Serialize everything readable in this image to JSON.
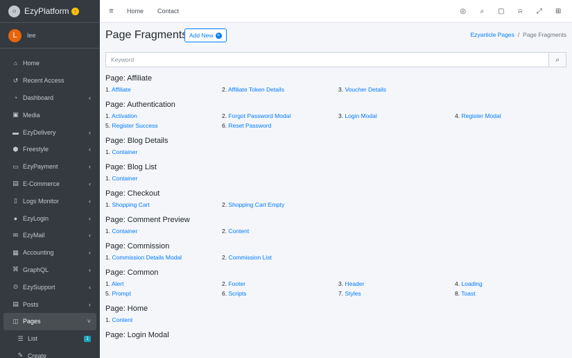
{
  "brand": {
    "name": "EzyPlatform",
    "badge": "↑"
  },
  "user": {
    "initial": "L",
    "name": "lee"
  },
  "sidebar": {
    "items": [
      {
        "label": "Home",
        "icon": "home-icon",
        "glyph": "⌂",
        "chevron": ""
      },
      {
        "label": "Recent Access",
        "icon": "history-icon",
        "glyph": "↺",
        "chevron": ""
      },
      {
        "label": "Dashboard",
        "icon": "dashboard-icon",
        "glyph": "◔",
        "chevron": "‹"
      },
      {
        "label": "Media",
        "icon": "image-icon",
        "glyph": "▣",
        "chevron": ""
      },
      {
        "label": "EzyDelivery",
        "icon": "truck-icon",
        "glyph": "▬",
        "chevron": "‹"
      },
      {
        "label": "Freestyle",
        "icon": "cube-icon",
        "glyph": "⬢",
        "chevron": "‹"
      },
      {
        "label": "EzyPayment",
        "icon": "credit-card-icon",
        "glyph": "▭",
        "chevron": "‹"
      },
      {
        "label": "E-Commerce",
        "icon": "store-icon",
        "glyph": "▤",
        "chevron": "‹"
      },
      {
        "label": "Logs Monitor",
        "icon": "file-icon",
        "glyph": "▯",
        "chevron": "‹"
      },
      {
        "label": "EzyLogin",
        "icon": "user-lock-icon",
        "glyph": "●",
        "chevron": "‹"
      },
      {
        "label": "EzyMail",
        "icon": "envelope-icon",
        "glyph": "✉",
        "chevron": "‹"
      },
      {
        "label": "Accounting",
        "icon": "calculator-icon",
        "glyph": "▦",
        "chevron": "‹"
      },
      {
        "label": "GraphQL",
        "icon": "project-diagram-icon",
        "glyph": "⌘",
        "chevron": "‹"
      },
      {
        "label": "EzySupport",
        "icon": "life-ring-icon",
        "glyph": "⊙",
        "chevron": "‹"
      },
      {
        "label": "Posts",
        "icon": "newspaper-icon",
        "glyph": "▤",
        "chevron": "‹"
      },
      {
        "label": "Pages",
        "icon": "columns-icon",
        "glyph": "◫",
        "chevron": "˅"
      }
    ],
    "sub_items": [
      {
        "label": "List",
        "icon": "list-icon",
        "glyph": "☰",
        "badge": "1"
      },
      {
        "label": "Create",
        "icon": "edit-icon",
        "glyph": "✎",
        "badge": ""
      }
    ]
  },
  "topbar": {
    "menu_glyph": "≡",
    "links": [
      "Home",
      "Contact"
    ],
    "icons": [
      {
        "name": "globe-icon",
        "glyph": "◎"
      },
      {
        "name": "search-icon",
        "glyph": "⌕"
      },
      {
        "name": "comments-icon",
        "glyph": "▢"
      },
      {
        "name": "bell-icon",
        "glyph": "⍾"
      },
      {
        "name": "expand-icon",
        "glyph": "⤢"
      },
      {
        "name": "th-large-icon",
        "glyph": "⊞"
      }
    ]
  },
  "page": {
    "title": "Page Fragments",
    "add_label": "Add New",
    "add_glyph": "+",
    "breadcrumb": {
      "link": "Ezyarticle Pages",
      "separator": "/",
      "current": "Page Fragments"
    },
    "search": {
      "placeholder": "Keyword",
      "value": "",
      "glyph": "⌕"
    }
  },
  "sections": [
    {
      "title": "Page: Affiliate",
      "items": [
        "Affiliate",
        "Affiliate Token Details",
        "Voucher Details"
      ]
    },
    {
      "title": "Page: Authentication",
      "items": [
        "Activation",
        "Forgot Password Modal",
        "Login Modal",
        "Register Modal",
        "Register Success",
        "Reset Password"
      ]
    },
    {
      "title": "Page: Blog Details",
      "items": [
        "Container"
      ]
    },
    {
      "title": "Page: Blog List",
      "items": [
        "Container"
      ]
    },
    {
      "title": "Page: Checkout",
      "items": [
        "Shopping Cart",
        "Shopping Cart Empty"
      ]
    },
    {
      "title": "Page: Comment Preview",
      "items": [
        "Container",
        "Content"
      ]
    },
    {
      "title": "Page: Commission",
      "items": [
        "Commission Details Modal",
        "Commission List"
      ]
    },
    {
      "title": "Page: Common",
      "items": [
        "Alert",
        "Footer",
        "Header",
        "Loading",
        "Prompt",
        "Scripts",
        "Styles",
        "Toast"
      ]
    },
    {
      "title": "Page: Home",
      "items": [
        "Content"
      ]
    },
    {
      "title": "Page: Login Modal",
      "items": []
    }
  ],
  "colors": {
    "sidebar_bg": "#343a40",
    "link": "#007bff",
    "content_bg": "#f4f6f9",
    "avatar": "#e8650a",
    "badge": "#17a2b8"
  }
}
